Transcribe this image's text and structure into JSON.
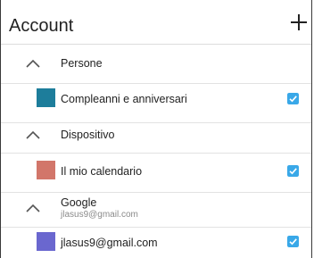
{
  "header": {
    "title": "Account",
    "add_icon": "plus-icon"
  },
  "groups": [
    {
      "label": "Persone",
      "sub": "",
      "expanded": true,
      "calendars": [
        {
          "label": "Compleanni e anniversari",
          "color": "#1d7d9b",
          "checked": true
        }
      ]
    },
    {
      "label": "Dispositivo",
      "sub": "",
      "expanded": true,
      "calendars": [
        {
          "label": "Il mio calendario",
          "color": "#d2766a",
          "checked": true
        }
      ]
    },
    {
      "label": "Google",
      "sub": "jlasus9@gmail.com",
      "expanded": true,
      "calendars": [
        {
          "label": "jlasus9@gmail.com",
          "color": "#6a67cf",
          "checked": true
        }
      ]
    }
  ],
  "colors": {
    "checkbox": "#39a8e8",
    "text": "#222222",
    "subtext": "#8a8a8a"
  }
}
